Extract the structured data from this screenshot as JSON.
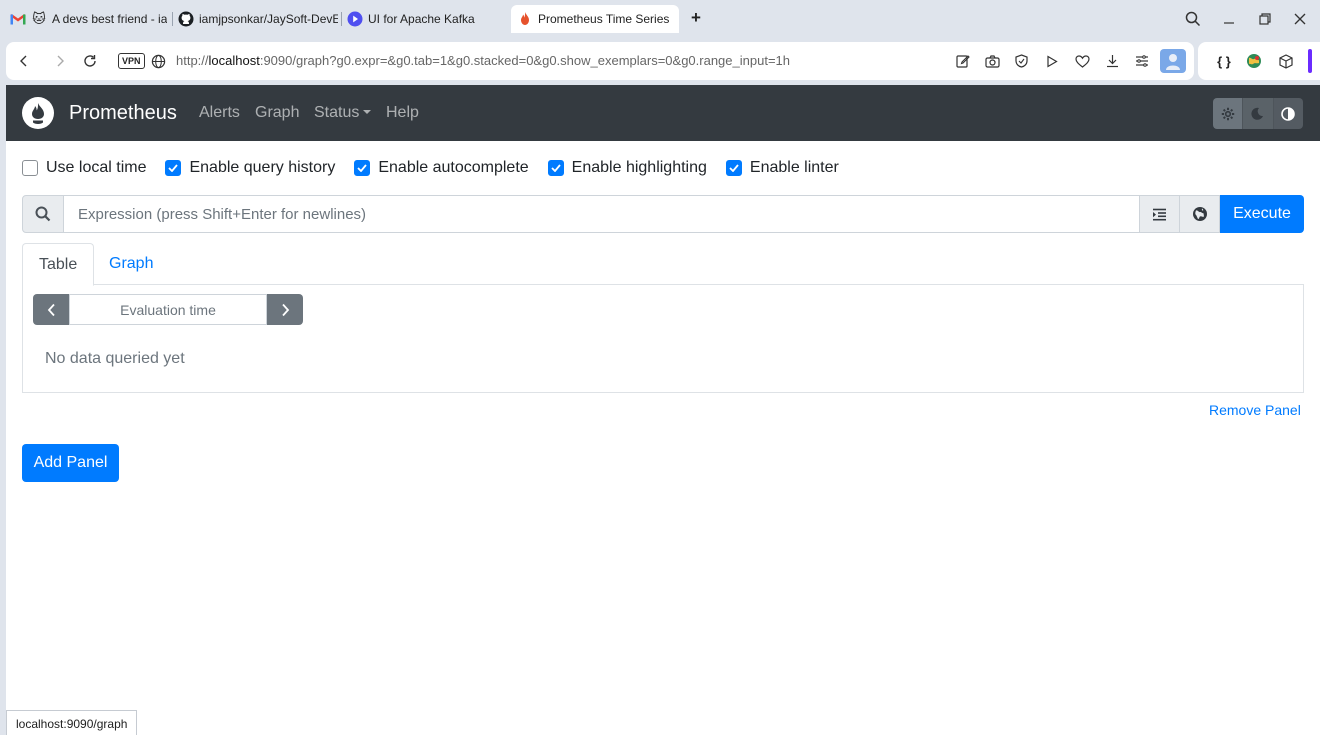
{
  "browser": {
    "tabs": [
      {
        "label": "A devs best friend - ia",
        "icon": "gmail-icon"
      },
      {
        "label": "iamjpsonkar/JaySoft-DevE",
        "icon": "github-icon"
      },
      {
        "label": "UI for Apache Kafka",
        "icon": "kafka-ui-icon"
      },
      {
        "label": "Prometheus Time Series C",
        "icon": "prometheus-icon"
      }
    ],
    "vpn_label": "VPN",
    "url_prefix": "http://",
    "url_host": "localhost",
    "url_rest": ":9090/graph?g0.expr=&g0.tab=1&g0.stacked=0&g0.show_exemplars=0&g0.range_input=1h",
    "status_url": "localhost:9090/graph",
    "ext_braces": "{ }"
  },
  "app": {
    "brand": "Prometheus",
    "nav": {
      "alerts": "Alerts",
      "graph": "Graph",
      "status": "Status",
      "help": "Help"
    },
    "options": {
      "local_time": {
        "label": "Use local time",
        "checked": false
      },
      "query_history": {
        "label": "Enable query history",
        "checked": true
      },
      "autocomplete": {
        "label": "Enable autocomplete",
        "checked": true
      },
      "highlighting": {
        "label": "Enable highlighting",
        "checked": true
      },
      "linter": {
        "label": "Enable linter",
        "checked": true
      }
    },
    "expression": {
      "placeholder": "Expression (press Shift+Enter for newlines)",
      "value": "",
      "execute_label": "Execute"
    },
    "panel_tabs": {
      "table": "Table",
      "graph": "Graph"
    },
    "eval_time_placeholder": "Evaluation time",
    "no_data": "No data queried yet",
    "remove_panel": "Remove Panel",
    "add_panel": "Add Panel"
  },
  "colors": {
    "primary": "#007bff",
    "navbar": "#343a40",
    "secondary": "#6c757d"
  }
}
